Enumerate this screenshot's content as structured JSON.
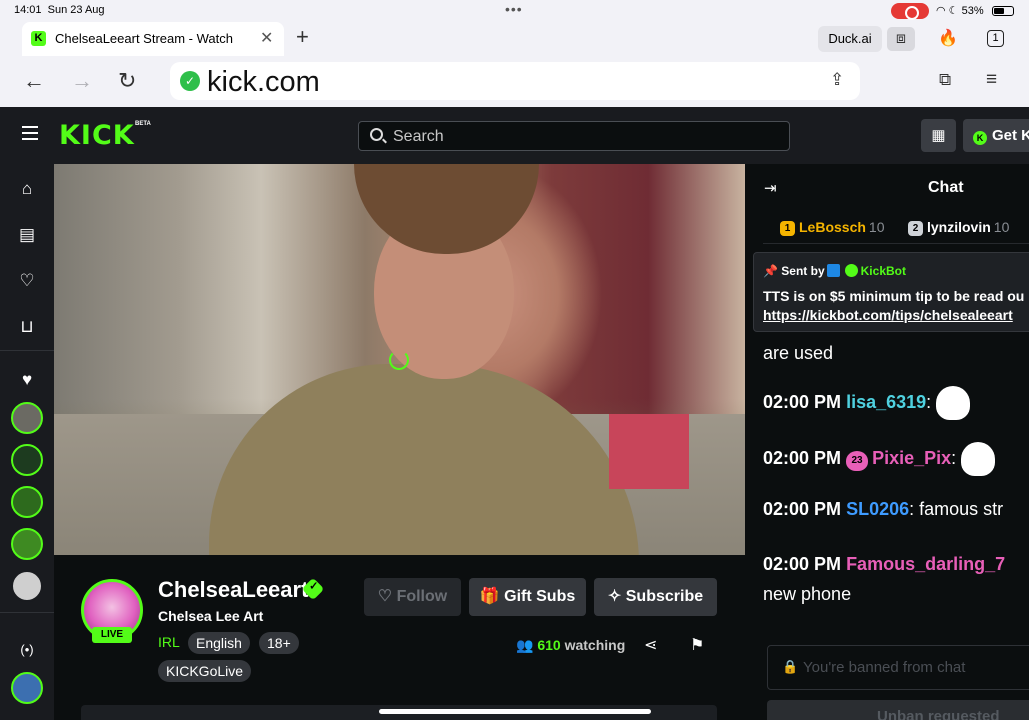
{
  "status_bar": {
    "time": "14:01",
    "date": "Sun 23 Aug",
    "battery": "53%"
  },
  "browser": {
    "tab_title": "ChelseaLeeart Stream - Watch",
    "favicon_letter": "K",
    "duck_ai": "Duck.ai",
    "tab_count": "1",
    "url": "kick.com"
  },
  "header": {
    "logo": "KICK",
    "beta": "BETA",
    "search_placeholder": "Search",
    "get_kick": "Get K"
  },
  "channel": {
    "name": "ChelseaLeeart",
    "subtitle": "Chelsea Lee Art",
    "live_label": "LIVE",
    "category": "IRL",
    "tags": [
      "English",
      "18+",
      "KICKGoLive"
    ],
    "follow_label": "Follow",
    "gift_label": "Gift Subs",
    "subscribe_label": "Subscribe",
    "viewer_count": "610",
    "viewer_suffix": "watching"
  },
  "chat": {
    "title": "Chat",
    "leaders": [
      {
        "rank": "1",
        "name": "LeBossch",
        "score": "10"
      },
      {
        "rank": "2",
        "name": "lynzilovin",
        "score": "10"
      }
    ],
    "pinned": {
      "sent_by": "Sent by",
      "bot_name": "KickBot",
      "text": "TTS is on $5 minimum tip to be read ou",
      "link": "https://kickbot.com/tips/chelsealeeart"
    },
    "fragment": "are used",
    "messages": [
      {
        "time": "02:00 PM",
        "user": "lisa_6319",
        "text": "",
        "color": "#4fd1e0"
      },
      {
        "time": "02:00 PM",
        "user": "Pixie_Pix",
        "badge": "23",
        "text": "",
        "color": "#e85fb8"
      },
      {
        "time": "02:00 PM",
        "user": "SL0206",
        "text": "famous str",
        "color": "#3e9bff"
      },
      {
        "time": "02:00 PM",
        "user": "Famous_darling_7",
        "text": "new phone",
        "color": "#e85fb8"
      }
    ],
    "input_placeholder": "You're banned from chat",
    "unban_label": "Unban requested"
  },
  "colors": {
    "brand": "#53fc18",
    "background": "#0b0e0f",
    "panel": "#191b1f"
  }
}
